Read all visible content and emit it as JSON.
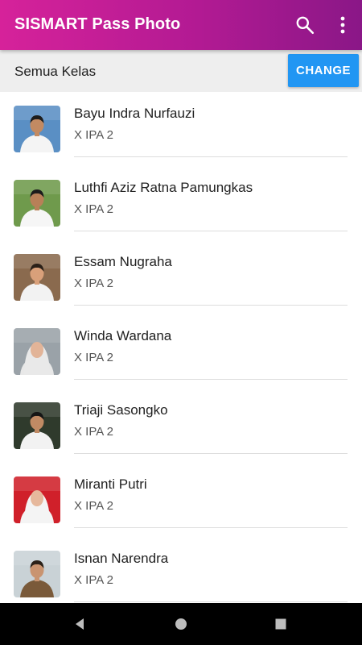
{
  "app": {
    "title": "SISMART Pass Photo",
    "accent_start": "#d6229a",
    "accent_end": "#8a1787",
    "actions": [
      "search-icon",
      "more-vert-icon"
    ]
  },
  "filter": {
    "label": "Semua Kelas",
    "button_label": "CHANGE",
    "button_color": "#2196f3"
  },
  "students": [
    {
      "name": "Bayu Indra Nurfauzi",
      "class": "X IPA 2",
      "photo_bg": "#5a8fc4",
      "shirt": "#f4f4f4",
      "hair": "#1d1d1d",
      "skin": "#c28a62",
      "headscarf": false
    },
    {
      "name": "Luthfi Aziz Ratna Pamungkas",
      "class": "X IPA 2",
      "photo_bg": "#6f9a4c",
      "shirt": "#f6f6f6",
      "hair": "#1b1b1b",
      "skin": "#b88058",
      "headscarf": false
    },
    {
      "name": "Essam Nugraha",
      "class": "X IPA 2",
      "photo_bg": "#8a6a4e",
      "shirt": "#f2f2f2",
      "hair": "#2a2018",
      "skin": "#d9a07a",
      "headscarf": false
    },
    {
      "name": "Winda Wardana",
      "class": "X IPA 2",
      "photo_bg": "#9aa2a8",
      "shirt": "#e8e8e8",
      "hair": "#e9e9e9",
      "skin": "#e2b498",
      "headscarf": true
    },
    {
      "name": "Triaji Sasongko",
      "class": "X IPA 2",
      "photo_bg": "#2f3a2c",
      "shirt": "#f2f2f2",
      "hair": "#151515",
      "skin": "#c08a64",
      "headscarf": false
    },
    {
      "name": "Miranti Putri",
      "class": "X IPA 2",
      "photo_bg": "#d0202a",
      "shirt": "#f4f4f4",
      "hair": "#f4f4f4",
      "skin": "#e6b89c",
      "headscarf": true
    },
    {
      "name": "Isnan Narendra",
      "class": "X IPA 2",
      "photo_bg": "#c9d2d6",
      "shirt": "#7a5a3a",
      "hair": "#2a2118",
      "skin": "#c99470",
      "headscarf": false
    }
  ],
  "system_nav": [
    "back-icon",
    "home-icon",
    "recents-icon"
  ]
}
